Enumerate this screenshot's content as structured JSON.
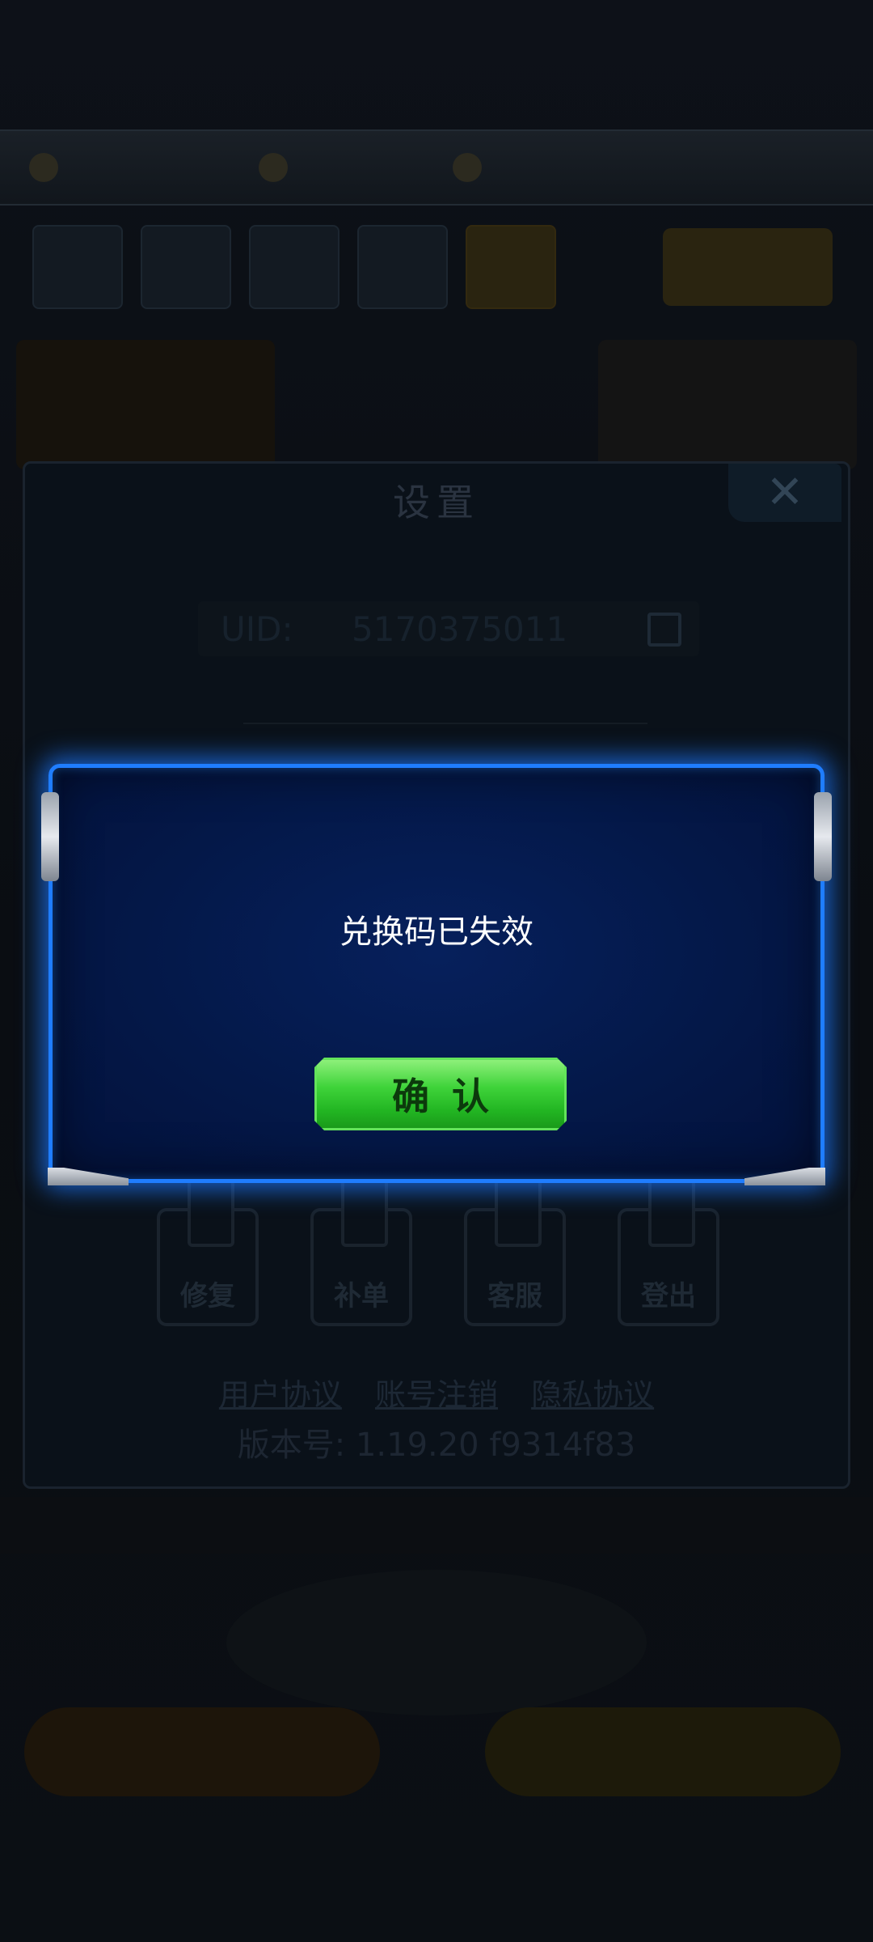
{
  "background": {
    "settings": {
      "title": "设置",
      "close_symbol": "✕",
      "uid_label": "UID:",
      "uid_value": "5170375011",
      "tools": [
        {
          "label": "修复",
          "icon": "wrench-icon"
        },
        {
          "label": "补单",
          "icon": "order-icon"
        },
        {
          "label": "客服",
          "icon": "headset-icon"
        },
        {
          "label": "登出",
          "icon": "logout-icon"
        }
      ],
      "links": [
        "用户协议",
        "账号注销",
        "隐私协议"
      ],
      "version": "版本号: 1.19.20  f9314f83"
    }
  },
  "dialog": {
    "message": "兑换码已失效",
    "confirm_label": "确认"
  },
  "colors": {
    "dialog_border": "#1f7dff",
    "dialog_bg": "#041848",
    "confirm_green": "#3fd33a"
  }
}
